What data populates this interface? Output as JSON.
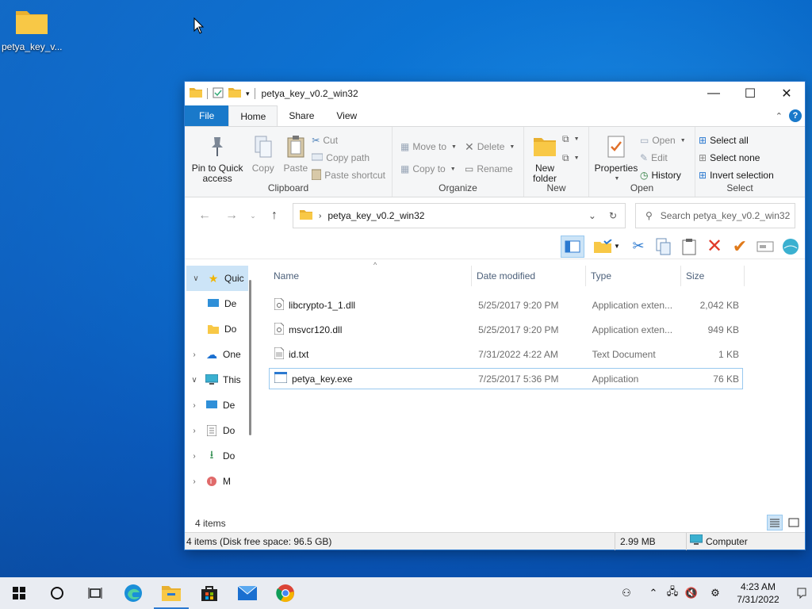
{
  "desktop": {
    "icon_label": "petya_key_v..."
  },
  "window": {
    "title": "petya_key_v0.2_win32",
    "controls": {
      "minimize": "—",
      "maximize": "☐",
      "close": "✕"
    },
    "tabs": {
      "file": "File",
      "home": "Home",
      "share": "Share",
      "view": "View"
    },
    "ribbon": {
      "clipboard": {
        "label": "Clipboard",
        "pin": "Pin to Quick access",
        "copy": "Copy",
        "paste": "Paste",
        "cut": "Cut",
        "copy_path": "Copy path",
        "paste_shortcut": "Paste shortcut"
      },
      "organize": {
        "label": "Organize",
        "move_to": "Move to",
        "copy_to": "Copy to",
        "delete": "Delete",
        "rename": "Rename"
      },
      "new": {
        "label": "New",
        "new_folder": "New folder"
      },
      "open": {
        "label": "Open",
        "properties": "Properties",
        "open": "Open",
        "edit": "Edit",
        "history": "History"
      },
      "select": {
        "label": "Select",
        "select_all": "Select all",
        "select_none": "Select none",
        "invert": "Invert selection"
      }
    },
    "address": {
      "crumb": "petya_key_v0.2_win32"
    },
    "search": {
      "placeholder": "Search petya_key_v0.2_win32"
    },
    "nav": {
      "items": [
        {
          "label": "Quic"
        },
        {
          "label": "De"
        },
        {
          "label": "Do"
        },
        {
          "label": "One"
        },
        {
          "label": "This"
        },
        {
          "label": "De"
        },
        {
          "label": "Do"
        },
        {
          "label": "Do"
        },
        {
          "label": "M"
        }
      ]
    },
    "columns": {
      "name": "Name",
      "date": "Date modified",
      "type": "Type",
      "size": "Size"
    },
    "files": [
      {
        "name": "libcrypto-1_1.dll",
        "date": "5/25/2017 9:20 PM",
        "type": "Application exten...",
        "size": "2,042 KB"
      },
      {
        "name": "msvcr120.dll",
        "date": "5/25/2017 9:20 PM",
        "type": "Application exten...",
        "size": "949 KB"
      },
      {
        "name": "id.txt",
        "date": "7/31/2022 4:22 AM",
        "type": "Text Document",
        "size": "1 KB"
      },
      {
        "name": "petya_key.exe",
        "date": "7/25/2017 5:36 PM",
        "type": "Application",
        "size": "76 KB"
      }
    ],
    "item_count": "4 items",
    "status": {
      "left": "4 items (Disk free space: 96.5 GB)",
      "size": "2.99 MB",
      "location": "Computer"
    }
  },
  "taskbar": {
    "time": "4:23 AM",
    "date": "7/31/2022"
  },
  "colors": {
    "accent": "#1979ca",
    "selection": "#cce4f7",
    "folder": "#f8c846"
  }
}
